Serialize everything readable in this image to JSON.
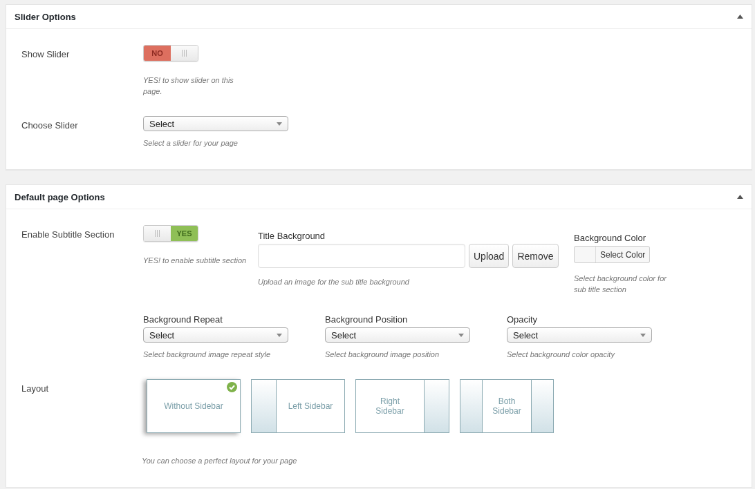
{
  "panels": [
    {
      "title": "Slider Options",
      "expanded": true,
      "rows": [
        {
          "label": "Show Slider",
          "items": [
            {
              "kind": "toggle",
              "on": false,
              "text": "NO",
              "hint": "YES! to show slider on this page."
            }
          ]
        },
        {
          "label": "Choose Slider",
          "items": [
            {
              "kind": "select",
              "value": "Select",
              "hint": "Select a slider for your page"
            }
          ]
        }
      ]
    },
    {
      "title": "Default page Options",
      "expanded": true,
      "rows": [
        {
          "label": "Enable Subtitle Section",
          "items": [
            {
              "kind": "toggle",
              "on": true,
              "text": "YES",
              "hint": "YES! to enable subtitle section"
            },
            {
              "kind": "upload",
              "label": "Title Background",
              "buttons": [
                "Upload",
                "Remove"
              ],
              "hint": "Upload an image for the sub title background"
            },
            {
              "kind": "color",
              "label": "Background Color",
              "button": "Select Color",
              "hint": "Select background color for sub title section"
            }
          ]
        },
        {
          "items": [
            {
              "kind": "select",
              "label": "Background Repeat",
              "value": "Select",
              "hint": "Select background image repeat style"
            },
            {
              "kind": "select",
              "label": "Background Position",
              "value": "Select",
              "hint": "Select background image position"
            },
            {
              "kind": "select",
              "label": "Opacity",
              "value": "Select",
              "hint": "Select background color opacity"
            }
          ]
        },
        {
          "label": "Layout",
          "items": [
            {
              "kind": "layout",
              "hint": "You can choose a perfect layout for your page",
              "options": [
                {
                  "kind": "none",
                  "text": "Without Sidebar",
                  "selected": true
                },
                {
                  "kind": "left",
                  "text": "Left Sidebar",
                  "selected": false
                },
                {
                  "kind": "right",
                  "text": "Right Sidebar",
                  "selected": false
                },
                {
                  "kind": "both",
                  "text": "Both Sidebar",
                  "selected": false
                }
              ]
            }
          ]
        }
      ]
    }
  ]
}
